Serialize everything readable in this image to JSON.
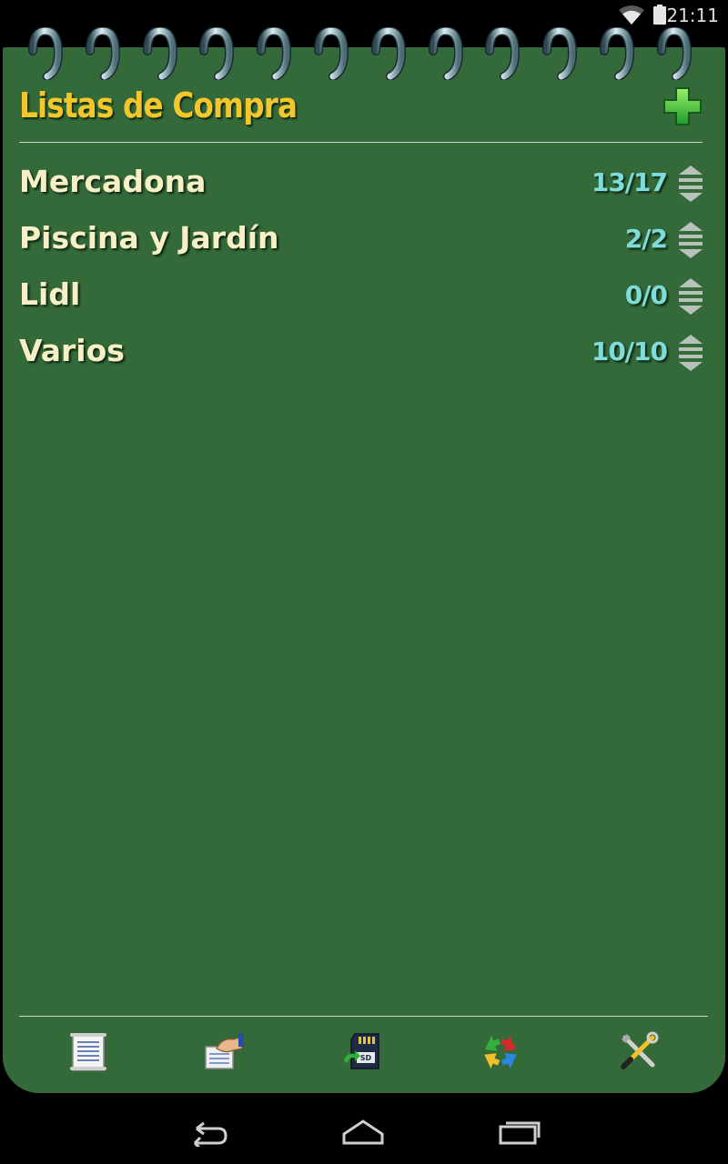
{
  "status_bar": {
    "time": "21:11",
    "wifi_icon": "wifi-icon",
    "battery_icon": "battery-icon"
  },
  "header": {
    "title": "Listas de Compra",
    "add_icon": "plus-icon"
  },
  "lists": [
    {
      "name": "Mercadona",
      "count": "13/17"
    },
    {
      "name": "Piscina y Jardín",
      "count": "2/2"
    },
    {
      "name": "Lidl",
      "count": "0/0"
    },
    {
      "name": "Varios",
      "count": "10/10"
    }
  ],
  "toolbar": {
    "items": [
      {
        "icon": "document-icon"
      },
      {
        "icon": "share-hand-icon"
      },
      {
        "icon": "sd-card-icon"
      },
      {
        "icon": "sync-arrows-icon"
      },
      {
        "icon": "tools-icon"
      }
    ]
  },
  "nav_bar": {
    "back_icon": "back-icon",
    "home_icon": "home-icon",
    "recents_icon": "recents-icon"
  },
  "colors": {
    "background": "#346a3a",
    "title": "#f3c72c",
    "item_text": "#f7f0c6",
    "count_text": "#7fdcd8"
  }
}
